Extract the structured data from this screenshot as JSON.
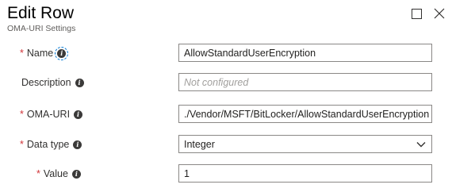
{
  "header": {
    "title": "Edit Row",
    "subtitle": "OMA-URI Settings"
  },
  "window_controls": {
    "maximize_icon": "square-icon",
    "close_icon": "x-icon"
  },
  "form": {
    "name": {
      "required_marker": "*",
      "label": "Name",
      "value": "AllowStandardUserEncryption"
    },
    "description": {
      "label": "Description",
      "value": "",
      "placeholder": "Not configured"
    },
    "oma_uri": {
      "required_marker": "*",
      "label": "OMA-URI",
      "value": "./Vendor/MSFT/BitLocker/AllowStandardUserEncryption"
    },
    "data_type": {
      "required_marker": "*",
      "label": "Data type",
      "selected": "Integer"
    },
    "value": {
      "required_marker": "*",
      "label": "Value",
      "value": "1"
    }
  },
  "colors": {
    "required": "#d13438",
    "focus_outline": "#0078d4",
    "border": "#8a8886",
    "placeholder": "#a19f9d"
  }
}
